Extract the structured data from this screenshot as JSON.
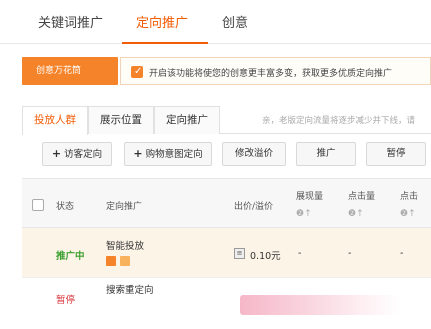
{
  "top_tabs": [
    "关键词推广",
    "定向推广",
    "创意"
  ],
  "ad_banner": "创意万花筒",
  "option": {
    "checked": true,
    "text": "开启该功能将使您的创意更丰富多变，获取更多优质定向推广"
  },
  "sub_tabs": [
    "投放人群",
    "展示位置",
    "定向推广"
  ],
  "sub_note": "亲，老版定向流量将逐步减少并下线，请",
  "toolbar": {
    "visitor": "访客定向",
    "cart": "购物意图定向",
    "modify_premium": "修改溢价",
    "promote": "推广",
    "pause": "暂停"
  },
  "table": {
    "headers": {
      "status": "状态",
      "targeting": "定向推广",
      "bid": "出价/溢价",
      "impressions": "展现量",
      "clicks": "点击量",
      "clicks_partial": "点击"
    },
    "sort_icons": "❷↑",
    "rows": [
      {
        "status": "推广中",
        "name": "智能投放",
        "bid": "0.10元",
        "impressions": "-",
        "clicks": "-",
        "extra": "-"
      },
      {
        "status": "暂停",
        "name": "搜索重定向"
      }
    ]
  },
  "colors": {
    "accent": "#f25c05",
    "banner": "#f5832a",
    "running": "#3a9f2d",
    "paused": "#d9363e"
  }
}
